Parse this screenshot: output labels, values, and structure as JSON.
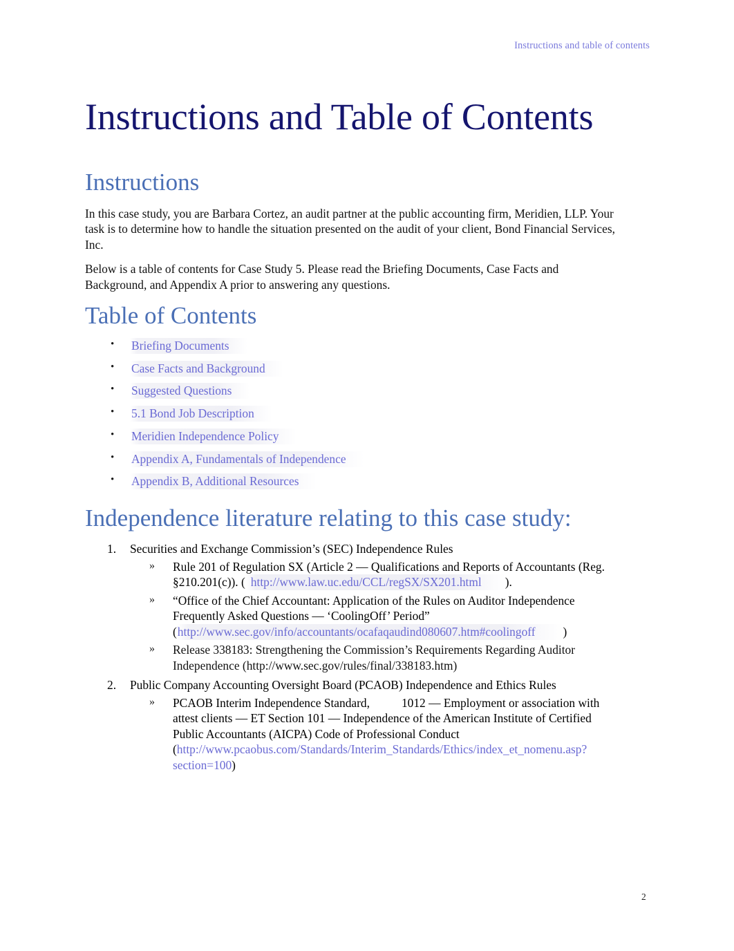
{
  "header": {
    "running_head": "Instructions and table of contents"
  },
  "title": "Instructions and Table of Contents",
  "instructions": {
    "heading": "Instructions",
    "paragraph_1": "In this case study, you are Barbara Cortez, an audit partner at the public accounting firm, Meridien, LLP. Your task is to determine how to handle the situation presented on the audit of your client, Bond Financial Services, Inc.",
    "paragraph_2": "Below is a table of contents for Case Study 5. Please read the Briefing Documents, Case Facts and Background, and Appendix A prior to answering any questions."
  },
  "table_of_contents": {
    "heading": "Table of Contents",
    "items": [
      {
        "label": "Briefing Documents"
      },
      {
        "label": "Case Facts and Background"
      },
      {
        "label": "Suggested Questions"
      },
      {
        "label": "5.1 Bond Job Description"
      },
      {
        "label": "Meridien Independence Policy"
      },
      {
        "label": "Appendix A, Fundamentals of Independence"
      },
      {
        "label": "Appendix B, Additional Resources"
      }
    ]
  },
  "literature": {
    "heading": "Independence literature relating to this case study:",
    "item_1": {
      "number": "1.",
      "title": "Securities and Exchange Commission’s (SEC) Independence Rules",
      "bullet_1": {
        "text_before": "Rule 201 of Regulation SX (Article 2 — Qualifications and Reports of Accountants (Reg. §210.201(c)). (",
        "link": "http://www.law.uc.edu/CCL/regSX/SX201.html",
        "text_after": ")."
      },
      "bullet_2": {
        "text_before": "“Office of the Chief Accountant: Application of the Rules on Auditor Independence Frequently Asked Questions — ‘CoolingOff’ Period” (",
        "link": "http://www.sec.gov/info/accountants/ocafaqaudind080607.htm#coolingoff",
        "text_after": ")"
      },
      "bullet_3": {
        "text": "Release 338183: Strengthening the Commission’s Requirements Regarding Auditor Independence (http://www.sec.gov/rules/final/338183.htm)"
      }
    },
    "item_2": {
      "number": "2.",
      "title": "Public Company Accounting Oversight Board (PCAOB) Independence and Ethics Rules",
      "bullet_1": {
        "text_before": "PCAOB Interim Independence Standard,",
        "text_middle": "1012 — Employment or association with attest clients — ET Section 101 — Independence of the American Institute of Certified Public Accountants (AICPA) Code of Professional Conduct (",
        "link": "http://www.pcaobus.com/Standards/Interim_Standards/Ethics/index_et_nomenu.asp?section=100",
        "text_after": ")"
      }
    }
  },
  "footer": {
    "page_number": "2"
  },
  "colors": {
    "title_navy": "#15156e",
    "heading_blue": "#4a6fb5",
    "link_periwinkle": "#6a6ad4",
    "running_head": "#7b7bdc",
    "body_text": "#111111",
    "page_background": "#ffffff"
  }
}
